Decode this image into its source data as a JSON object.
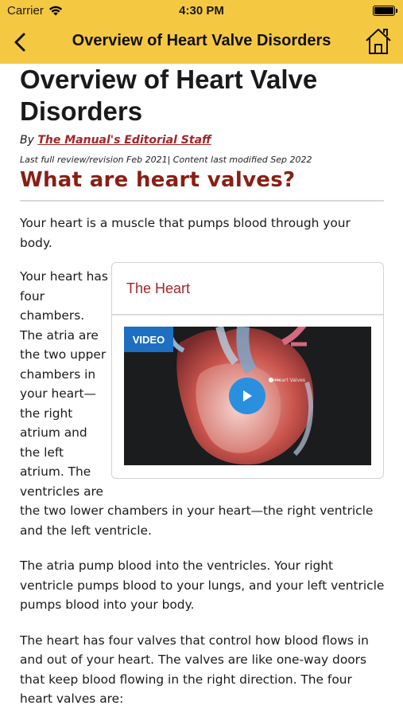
{
  "status_bar": {
    "carrier": "Carrier",
    "time": "4:30 PM"
  },
  "nav": {
    "title": "Overview of Heart Valve Disorders",
    "back_icon": "chevron-left-icon",
    "home_icon": "home-icon"
  },
  "article": {
    "title": "Overview of Heart Valve Disorders",
    "byline_prefix": "By",
    "author": "The Manual's Editorial Staff",
    "review_line": "Last full review/revision Feb 2021| Content last modified Sep 2022",
    "section_heading": "What are heart valves?",
    "paragraph_1": "Your heart is a muscle that pumps blood through your body.",
    "paragraph_2_narrow": "Your heart has four chambers. The atria are the two upper chambers in your heart—the right atrium and the left atrium. The ventricles are",
    "paragraph_2_full": "the two lower chambers in your heart—the right ventricle and the left ventricle.",
    "paragraph_3": "The atria pump blood into the ventricles. Your right ventricle pumps blood to your lungs, and your left ventricle pumps blood into your body.",
    "paragraph_4": "The heart has four valves that control how blood flows in and out of your heart. The valves are like one-way doors that keep blood flowing in the right direction. The four heart valves are:"
  },
  "media_card": {
    "title": "The Heart",
    "badge": "VIDEO",
    "video_label": "Heart Valves",
    "play_icon": "play-icon"
  },
  "colors": {
    "nav_bg": "#f5c842",
    "heading_red": "#8a1e14",
    "link_red": "#a32626",
    "video_badge_blue": "#1d6fc2",
    "play_blue": "#2b8fe0"
  }
}
